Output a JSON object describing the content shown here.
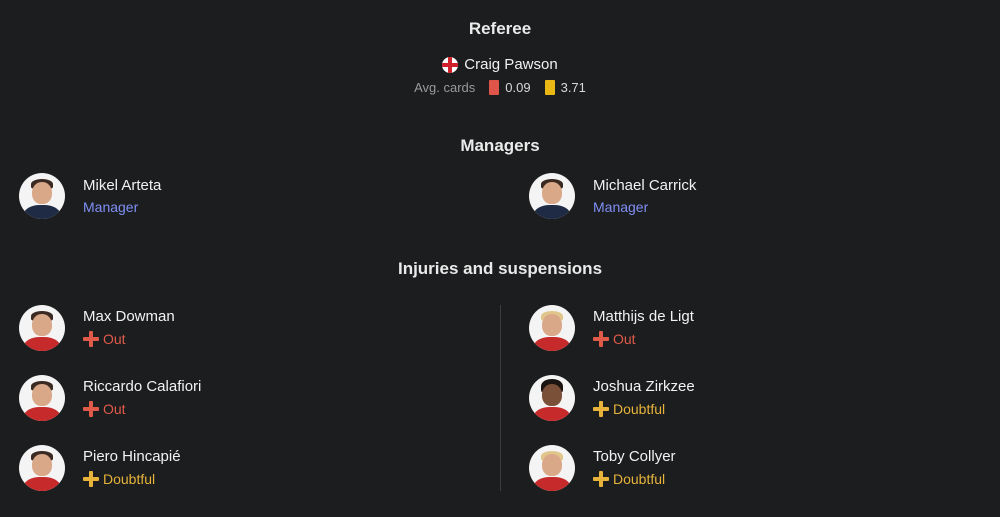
{
  "referee": {
    "section_title": "Referee",
    "name": "Craig Pawson",
    "flag_icon": "england-flag-icon",
    "avg_cards_label": "Avg. cards",
    "red_cards": "0.09",
    "yellow_cards": "3.71",
    "colors": {
      "red": "#e0554a",
      "yellow": "#e9b814"
    }
  },
  "managers": {
    "section_title": "Managers",
    "home": {
      "name": "Mikel Arteta",
      "role": "Manager"
    },
    "away": {
      "name": "Michael Carrick",
      "role": "Manager"
    }
  },
  "injuries": {
    "section_title": "Injuries and suspensions",
    "home": [
      {
        "name": "Max Dowman",
        "status": "Out"
      },
      {
        "name": "Riccardo Calafiori",
        "status": "Out"
      },
      {
        "name": "Piero Hincapié",
        "status": "Doubtful"
      }
    ],
    "away": [
      {
        "name": "Matthijs de Ligt",
        "status": "Out"
      },
      {
        "name": "Joshua Zirkzee",
        "status": "Doubtful"
      },
      {
        "name": "Toby Collyer",
        "status": "Doubtful"
      }
    ],
    "status_colors": {
      "Out": "#e05a4a",
      "Doubtful": "#e7b33b"
    }
  }
}
